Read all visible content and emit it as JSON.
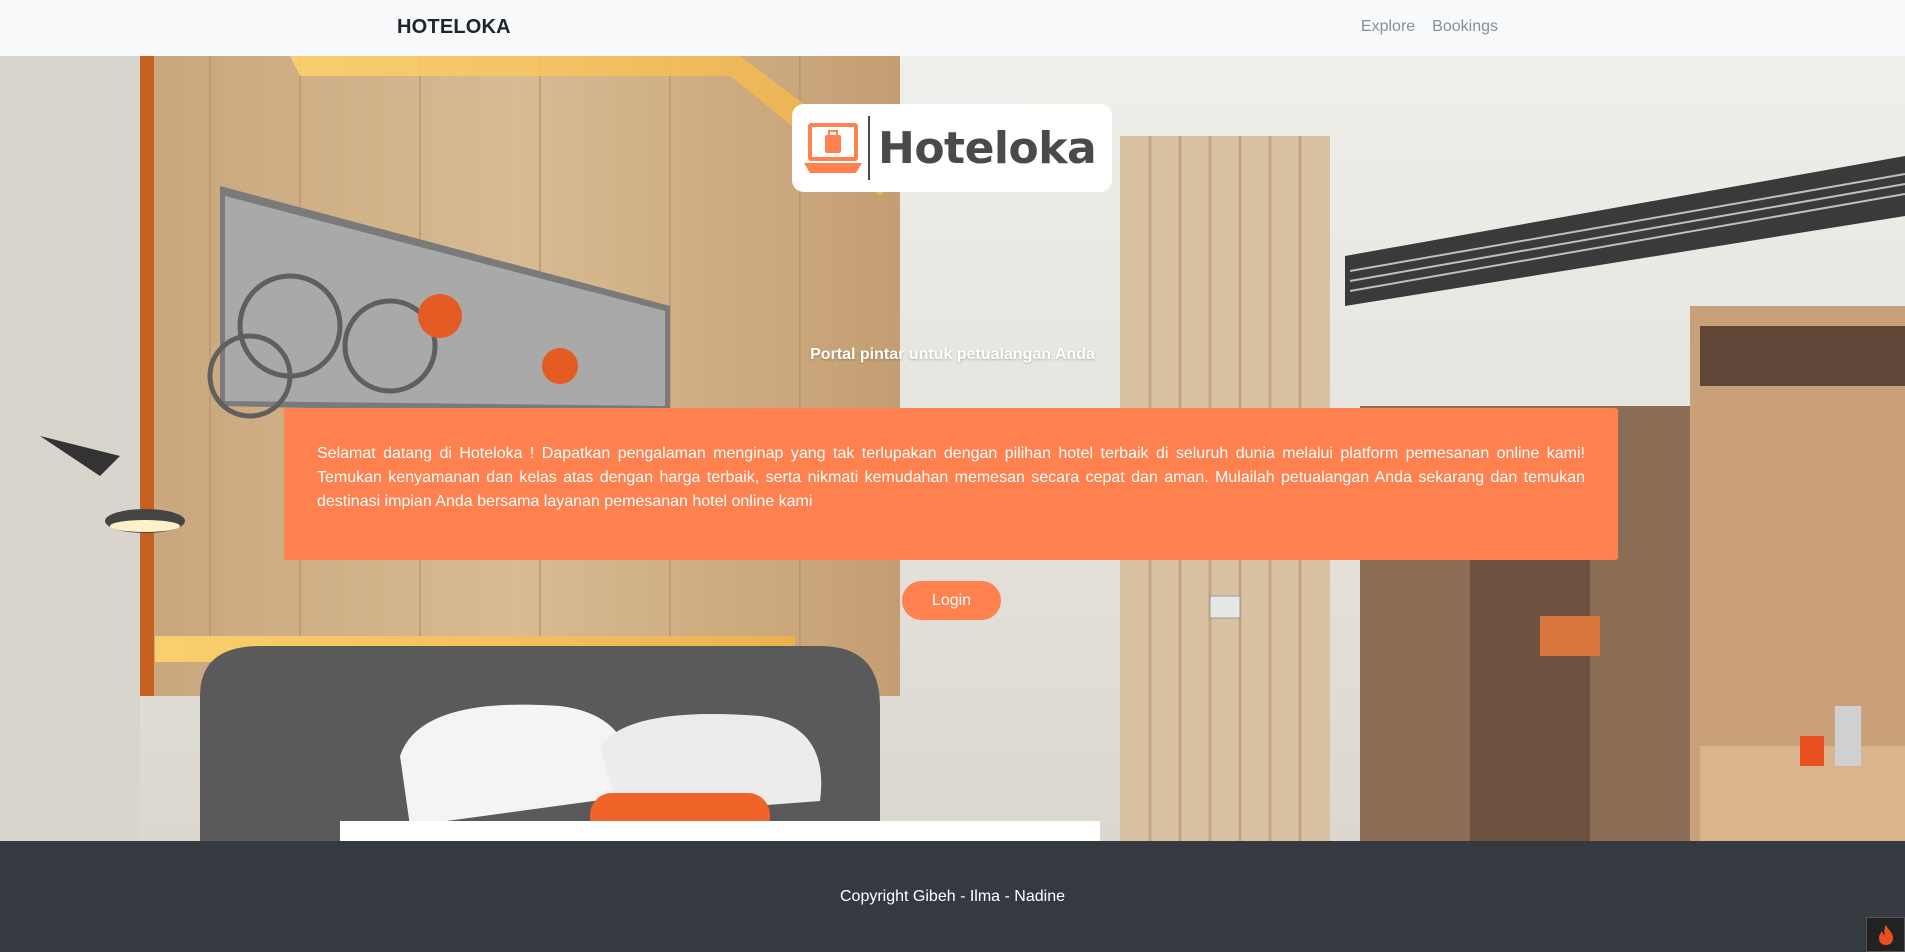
{
  "navbar": {
    "brand": "HOTELOKA",
    "links": [
      {
        "label": "Explore"
      },
      {
        "label": "Bookings"
      }
    ]
  },
  "hero": {
    "logo": {
      "word": "Hoteloka",
      "icon": "laptop-suitcase-icon"
    },
    "tagline": "Portal pintar untuk petualangan Anda",
    "welcome": "Selamat datang di Hoteloka ! Dapatkan pengalaman menginap yang tak terlupakan dengan pilihan hotel terbaik di seluruh dunia melalui platform pemesanan online kami! Temukan kenyamanan dan kelas atas dengan harga terbaik, serta nikmati kemudahan memesan secara cepat dan aman. Mulailah petualangan Anda sekarang dan temukan destinasi impian Anda bersama layanan pemesanan hotel online kami",
    "login_label": "Login"
  },
  "footer": {
    "copyright": "Copyright Gibeh - Ilma - Nadine"
  },
  "colors": {
    "accent": "#ff8150",
    "navbar_bg": "#f8f9fa",
    "footer_bg": "#343a40"
  }
}
